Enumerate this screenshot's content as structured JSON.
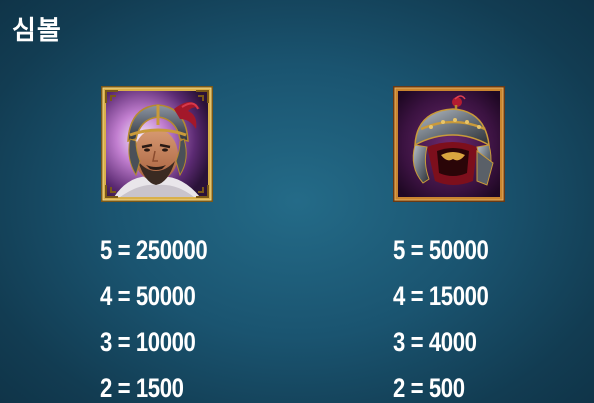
{
  "title": "심볼",
  "symbols": [
    {
      "icon": "warrior-portrait-icon",
      "frame_color": "#c9a241",
      "payouts": [
        "5 = 250000",
        "4 = 50000",
        "3 = 10000",
        "2 = 1500"
      ]
    },
    {
      "icon": "helmet-icon",
      "frame_color": "#c9852f",
      "payouts": [
        "5 = 50000",
        "4 = 15000",
        "3 = 4000",
        "2 = 500"
      ]
    }
  ]
}
